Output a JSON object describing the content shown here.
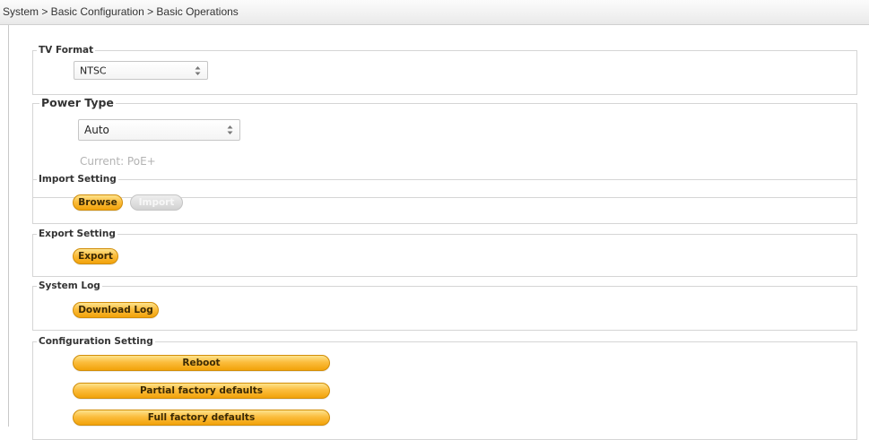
{
  "breadcrumb": {
    "text": "System > Basic Configuration > Basic Operations"
  },
  "tv_format": {
    "legend": "TV Format",
    "select_value": "NTSC"
  },
  "power_type": {
    "legend": "Power Type",
    "select_value": "Auto",
    "current_status": "Current: PoE+"
  },
  "import_setting": {
    "legend": "Import Setting",
    "browse_label": "Browse",
    "import_label": "Import"
  },
  "export_setting": {
    "legend": "Export Setting",
    "export_label": "Export"
  },
  "system_log": {
    "legend": "System Log",
    "download_label": "Download Log"
  },
  "configuration_setting": {
    "legend": "Configuration Setting",
    "reboot_label": "Reboot",
    "partial_label": "Partial factory defaults",
    "full_label": "Full factory defaults"
  },
  "colors": {
    "accent_orange": "#fbbd3d",
    "disabled_gray": "#dddddd",
    "status_gray": "#b3b3b3"
  },
  "icons": {
    "select_arrows": "select-arrows-icon"
  }
}
